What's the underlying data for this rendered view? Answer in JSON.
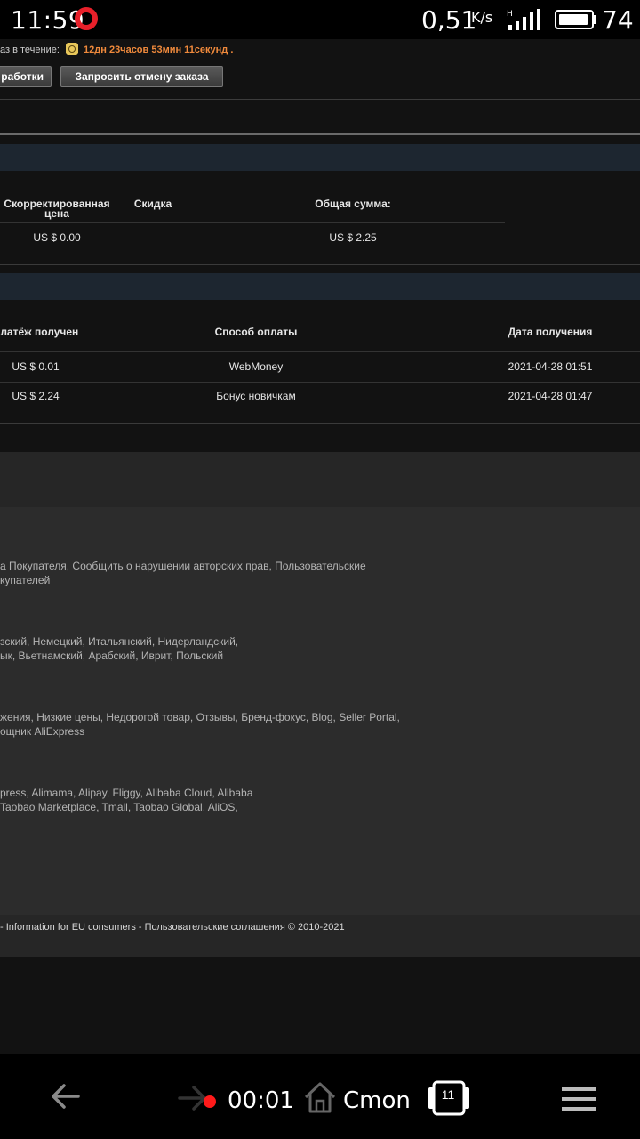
{
  "status_bar": {
    "time": "11:59",
    "speed": "0,51",
    "speed_unit": "K/s",
    "battery": "74"
  },
  "order": {
    "deadline_label": "аз в течение:",
    "countdown": "12дн 23часов 53мин 11секунд",
    "countdown_suffix": ".",
    "button_extend": "работки",
    "button_cancel": "Запросить отмену заказа"
  },
  "price_table": {
    "headers": [
      "Скорректированная цена",
      "Скидка",
      "Общая сумма:"
    ],
    "row": [
      "US $ 0.00",
      "",
      "US $ 2.25"
    ]
  },
  "payment_table": {
    "headers": [
      "Платёж получен",
      "Способ оплаты",
      "Дата получения"
    ],
    "rows": [
      [
        "US $ 0.01",
        "WebMoney",
        "2021-04-28 01:51"
      ],
      [
        "US $ 2.24",
        "Бонус новичкам",
        "2021-04-28 01:47"
      ]
    ]
  },
  "footer": {
    "links_1": [
      "а Покупателя, Сообщить о нарушении авторских прав, Пользовательские",
      "купателей"
    ],
    "links_2": [
      "зский, Немецкий, Итальянский, Нидерландский,",
      "ык, Вьетнамский, Арабский, Иврит, Польский"
    ],
    "links_3": [
      "жения, Низкие цены, Недорогой товар, Отзывы, Бренд-фокус, Blog, Seller Portal,",
      "ощник AliExpress"
    ],
    "links_4": [
      "press, Alimama, Alipay, Fliggy, Alibaba Cloud, Alibaba",
      "Taobao Marketplace, Tmall, Taobao Global, AliOS,"
    ],
    "bottom_line": "- Information for EU consumers  -  Пользовательские соглашения  © 2010-2021"
  },
  "nav_bar": {
    "rec_time": "00:01",
    "home_label": "Cmon",
    "tabs_count": "11"
  }
}
